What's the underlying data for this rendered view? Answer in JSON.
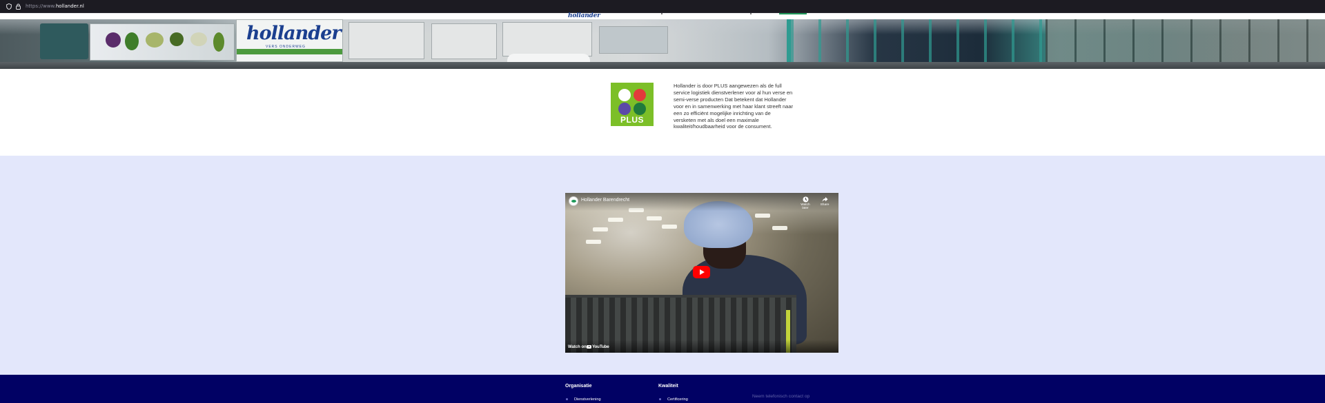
{
  "browser": {
    "url_prefix": "https://www.",
    "url_host": "hollander.nl"
  },
  "header": {
    "logo_text": "hollander"
  },
  "hero": {
    "trailer_brand": "hollander",
    "trailer_sub": "VERS ONDERWEG"
  },
  "intro": {
    "logo_word": "PLUS",
    "paragraph": "Hollander is door PLUS aangewezen als de full service logistiek dienstverlener voor al hun verse en semi-verse producten Dat betekent dat Hollander voor en in samenwerking met haar klant streeft naar een zo efficiënt mogelijke inrichting van de versketen met als doel een maximale kwaliteit/houdbaarheid voor de consument.",
    "plus_colors": [
      "#ffffff",
      "#e23b3b",
      "#5b4aa8",
      "#1f7a3c"
    ]
  },
  "video": {
    "title": "Hollander Barendrecht",
    "watch_later": "Watch later",
    "share": "Share",
    "watch_on": "Watch on",
    "youtube": "YouTube"
  },
  "footer": {
    "columns": [
      {
        "heading": "Organisatie",
        "link": "Dienstverlening"
      },
      {
        "heading": "Kwaliteit",
        "link": "Certificering"
      }
    ],
    "contact_placeholder": "Neem telefonisch contact op"
  },
  "colors": {
    "brand_blue": "#1b3f8f",
    "brand_green": "#1f9a5a",
    "footer_navy": "#010164",
    "section_lavender": "#e3e7fb",
    "youtube_red": "#ff0000"
  }
}
